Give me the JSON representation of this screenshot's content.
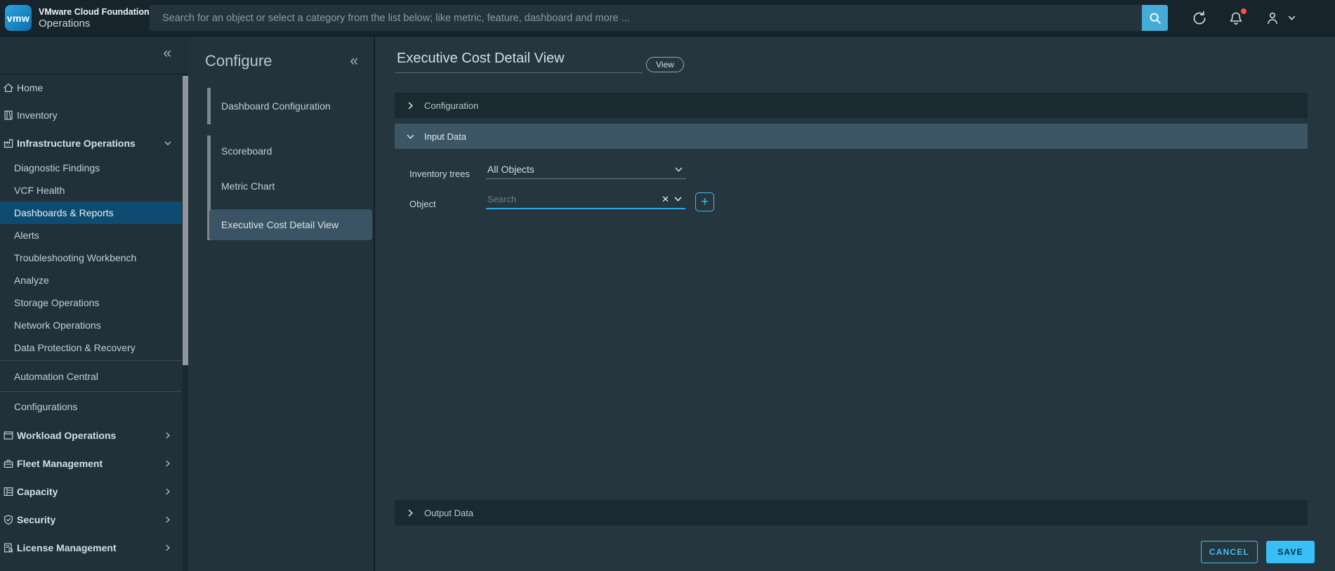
{
  "colors": {
    "accent_blue": "#44bdf2",
    "save_fill": "#38bff7",
    "search_button": "#45acd8",
    "selected_nav": "#0d4c70",
    "selected_config_item": "#3a5465",
    "expanded_section": "#3c5666",
    "notification_dot": "#f55348",
    "focus_underline": "#2aa7e8"
  },
  "header": {
    "logo_text": "vmw",
    "brand_line1": "VMware Cloud Foundation",
    "brand_line2": "Operations",
    "search_placeholder": "Search for an object or select a category from the list below; like metric, feature, dashboard and more ..."
  },
  "sidebar": {
    "collapse_glyph": "«",
    "items": [
      {
        "label": "Home"
      },
      {
        "label": "Inventory"
      },
      {
        "label": "Infrastructure Operations"
      },
      {
        "label": "Diagnostic Findings"
      },
      {
        "label": "VCF Health"
      },
      {
        "label": "Dashboards & Reports",
        "selected": true
      },
      {
        "label": "Alerts"
      },
      {
        "label": "Troubleshooting Workbench"
      },
      {
        "label": "Analyze"
      },
      {
        "label": "Storage Operations"
      },
      {
        "label": "Network Operations"
      },
      {
        "label": "Data Protection & Recovery"
      },
      {
        "label": "Automation Central"
      },
      {
        "label": "Configurations"
      },
      {
        "label": "Workload Operations"
      },
      {
        "label": "Fleet Management"
      },
      {
        "label": "Capacity"
      },
      {
        "label": "Security"
      },
      {
        "label": "License Management"
      }
    ]
  },
  "configure_panel": {
    "title": "Configure",
    "collapse_glyph": "«",
    "items": [
      {
        "label": "Dashboard Configuration"
      },
      {
        "label": "Scoreboard"
      },
      {
        "label": "Metric Chart"
      },
      {
        "label": "Executive Cost Detail View",
        "selected": true
      }
    ]
  },
  "main": {
    "title_value": "Executive Cost Detail View",
    "view_badge": "View",
    "sections": {
      "configuration": "Configuration",
      "input_data": "Input Data",
      "output_data": "Output Data"
    },
    "form": {
      "inventory_label": "Inventory trees",
      "inventory_value": "All Objects",
      "object_label": "Object",
      "object_placeholder": "Search",
      "clear_glyph": "✕",
      "add_glyph": "+"
    },
    "footer": {
      "cancel": "CANCEL",
      "save": "SAVE"
    }
  }
}
